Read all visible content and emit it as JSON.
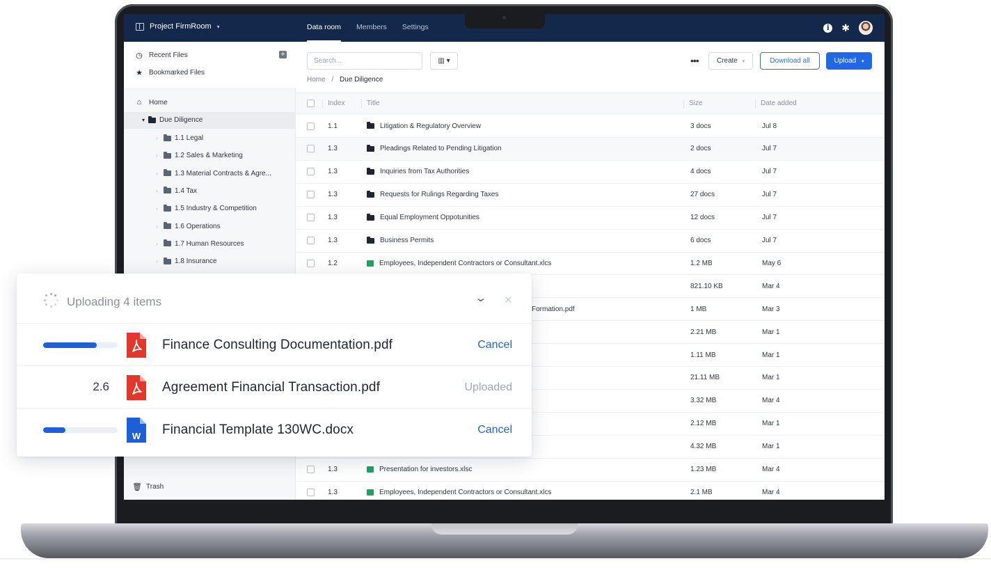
{
  "topbar": {
    "project": "Project FirmRoom",
    "tabs": [
      {
        "label": "Data room",
        "active": true
      },
      {
        "label": "Members",
        "active": false
      },
      {
        "label": "Settings",
        "active": false
      }
    ]
  },
  "sidebar": {
    "recent": "Recent Files",
    "bookmarked": "Bookmarked Files",
    "home": "Home",
    "root_folder": "Due Diligence",
    "folders": [
      "1.1 Legal",
      "1.2 Sales & Marketing",
      "1.3 Material Contracts & Agre...",
      "1.4 Tax",
      "1.5 Industry & Competition",
      "1.6 Operations",
      "1.7 Human Resources",
      "1.8 Insurance"
    ],
    "trash": "Trash"
  },
  "toolbar": {
    "search_placeholder": "Search...",
    "view_label": "▥ ▾",
    "more": "•••",
    "create": "Create",
    "download_all": "Download all",
    "upload": "Upload"
  },
  "breadcrumb": {
    "home": "Home",
    "sep": "/",
    "current": "Due Diligence"
  },
  "table": {
    "headers": {
      "index": "Index",
      "title": "Title",
      "size": "Size",
      "date": "Date added"
    },
    "rows": [
      {
        "index": "1.1",
        "title": "Litigation & Regulatory Overview",
        "size": "3 docs",
        "date": "Jul 8",
        "type": "folder"
      },
      {
        "index": "1.3",
        "title": "Pleadings Related to Pending Litigation",
        "size": "2 docs",
        "date": "Jul 7",
        "type": "folder"
      },
      {
        "index": "1.3",
        "title": "Inquiries from Tax Authorities",
        "size": "4 docs",
        "date": "Jul 7",
        "type": "folder"
      },
      {
        "index": "1.3",
        "title": "Requests for Rulings Regarding Taxes",
        "size": "27 docs",
        "date": "Jul 7",
        "type": "folder"
      },
      {
        "index": "1.3",
        "title": "Equal Employment Oppotunities",
        "size": "12 docs",
        "date": "Jul 7",
        "type": "folder"
      },
      {
        "index": "1.3",
        "title": "Business Permits",
        "size": "6 docs",
        "date": "Jul 7",
        "type": "folder"
      },
      {
        "index": "1.2",
        "title": "Employees, Independent Contractors or Consultant.xlcs",
        "size": "1.2 MB",
        "date": "May 6",
        "type": "xls"
      },
      {
        "index": "",
        "title": "",
        "size": "821.10 KB",
        "date": "Mar 4",
        "type": "hidden"
      },
      {
        "index": "",
        "title": "Formation.pdf",
        "size": "1 MB",
        "date": "Mar 3",
        "type": "hidden"
      },
      {
        "index": "",
        "title": "",
        "size": "2.21 MB",
        "date": "Mar 1",
        "type": "hidden"
      },
      {
        "index": "",
        "title": "",
        "size": "1.11 MB",
        "date": "Mar 1",
        "type": "hidden"
      },
      {
        "index": "",
        "title": "",
        "size": "21.11 MB",
        "date": "Mar 1",
        "type": "hidden"
      },
      {
        "index": "",
        "title": "",
        "size": "3.32 MB",
        "date": "Mar 4",
        "type": "hidden"
      },
      {
        "index": "",
        "title": "",
        "size": "2.12 MB",
        "date": "Mar 1",
        "type": "hidden"
      },
      {
        "index": "",
        "title": "",
        "size": "4.32 MB",
        "date": "Mar 1",
        "type": "hidden"
      },
      {
        "index": "1.3",
        "title": "Presentation for investors.xlsc",
        "size": "1.23 MB",
        "date": "Mar 4",
        "type": "xls"
      },
      {
        "index": "1.3",
        "title": "Employees, Independent Contractors or Consultant.xlcs",
        "size": "2.1 MB",
        "date": "Mar 4",
        "type": "xls"
      }
    ]
  },
  "upload_panel": {
    "title": "Uploading 4 items",
    "items": [
      {
        "name": "Finance Consulting Documentation.pdf",
        "kind": "pdf",
        "progress": 0.72,
        "size_text": "",
        "status": "Cancel"
      },
      {
        "name": "Agreement Financial Transaction.pdf",
        "kind": "pdf",
        "progress": null,
        "size_text": "2.6",
        "status": "Uploaded"
      },
      {
        "name": "Financial Template 130WC.docx",
        "kind": "docx",
        "progress": 0.3,
        "size_text": "",
        "status": "Cancel"
      }
    ]
  },
  "colors": {
    "nav": "#13284b",
    "accent": "#2168e6",
    "pdf": "#e2382b",
    "word": "#1c5fd6",
    "xls": "#22a262"
  }
}
